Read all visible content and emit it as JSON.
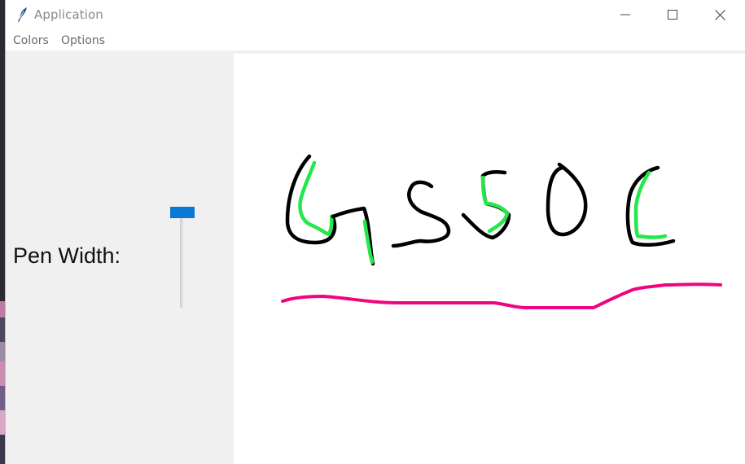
{
  "window": {
    "title": "Application",
    "icon": "feather-icon",
    "controls": [
      "minimize-icon",
      "maximize-icon",
      "close-icon"
    ]
  },
  "menubar": {
    "items": [
      {
        "label": "Colors"
      },
      {
        "label": "Options"
      }
    ]
  },
  "left_panel": {
    "pen_width_label": "Pen Width:",
    "slider_value": 0,
    "slider_accent": "#0a78d6"
  },
  "canvas": {
    "background": "#ffffff",
    "stroke_colors": {
      "black": "#000000",
      "green": "#22e84a",
      "pink": "#f0047f"
    }
  }
}
